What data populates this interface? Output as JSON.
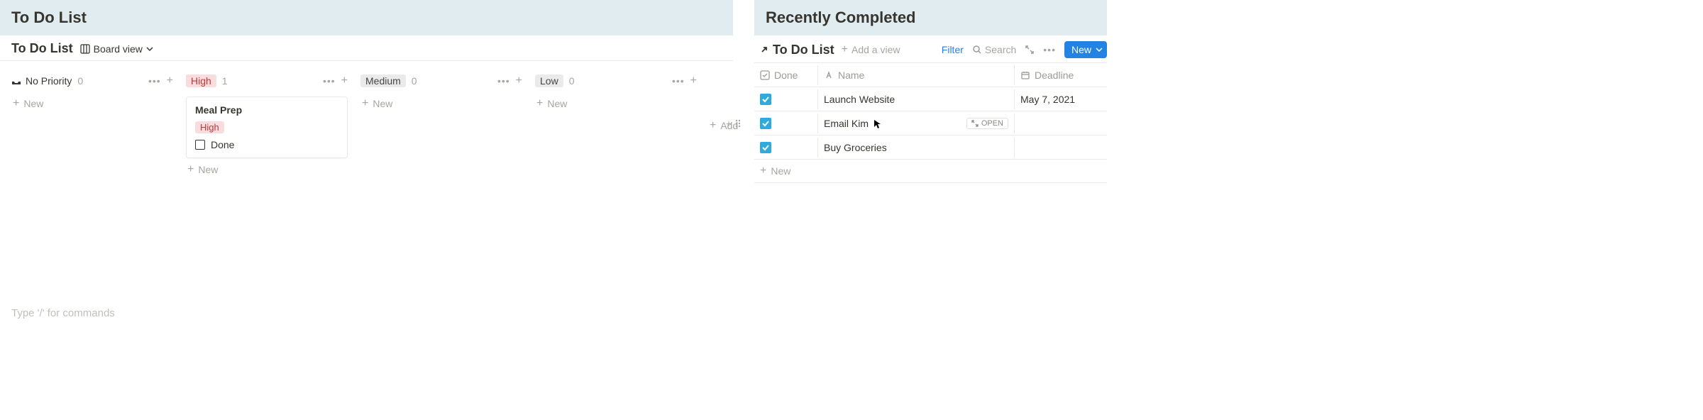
{
  "left": {
    "title": "To Do List",
    "db_title": "To Do List",
    "view_label": "Board view",
    "add_column_label": "Add",
    "new_label": "New",
    "slash_placeholder": "Type '/' for commands",
    "columns": [
      {
        "name": "No Priority",
        "count": "0",
        "type": "no-priority"
      },
      {
        "name": "High",
        "count": "1",
        "type": "high"
      },
      {
        "name": "Medium",
        "count": "0",
        "type": "medium"
      },
      {
        "name": "Low",
        "count": "0",
        "type": "low"
      }
    ],
    "card": {
      "title": "Meal Prep",
      "tag": "High",
      "checkbox_label": "Done"
    }
  },
  "right": {
    "title": "Recently Completed",
    "db_title": "To Do List",
    "add_view_label": "Add a view",
    "filter_label": "Filter",
    "search_label": "Search",
    "new_button": "New",
    "new_row_label": "New",
    "open_label": "OPEN",
    "columns": {
      "done": "Done",
      "name": "Name",
      "deadline": "Deadline"
    },
    "rows": [
      {
        "done": true,
        "name": "Launch Website",
        "deadline": "May 7, 2021"
      },
      {
        "done": true,
        "name": "Email Kim",
        "deadline": ""
      },
      {
        "done": true,
        "name": "Buy Groceries",
        "deadline": ""
      }
    ]
  }
}
